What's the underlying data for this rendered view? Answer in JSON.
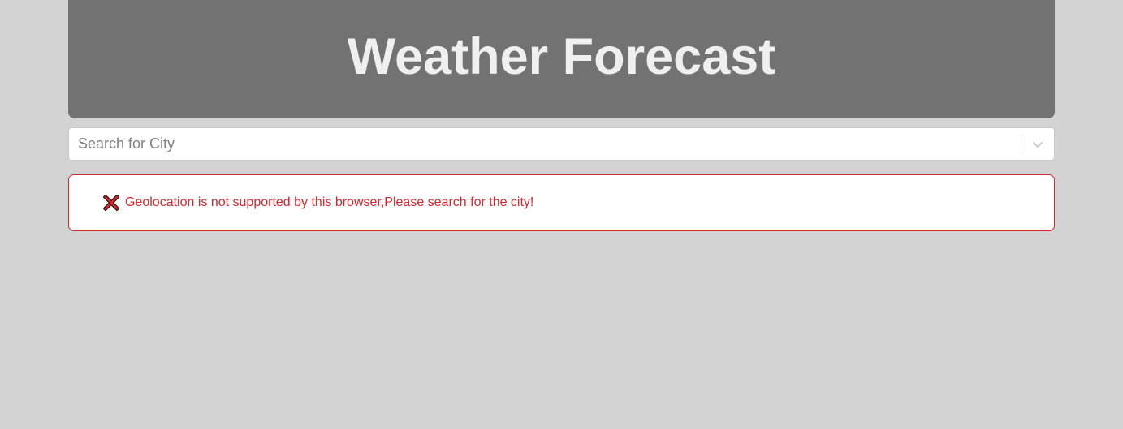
{
  "header": {
    "title": "Weather Forecast"
  },
  "search": {
    "placeholder": "Search for City",
    "dropdown_icon": "chevron-down-icon"
  },
  "alert": {
    "icon": "close-x-icon",
    "message": "Geolocation is not supported by this browser,Please search for the city!",
    "color": "#d9262c"
  },
  "colors": {
    "background": "#d3d3d3",
    "header_background": "#727272",
    "header_text": "#efefef"
  }
}
